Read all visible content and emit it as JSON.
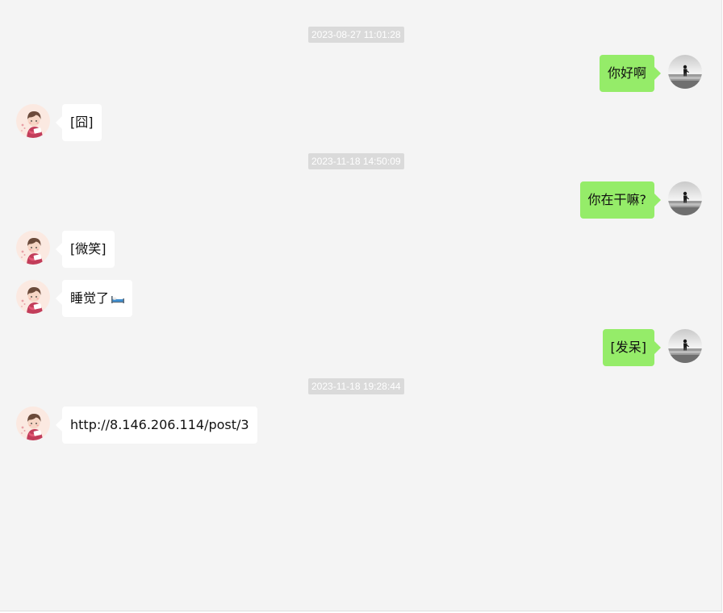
{
  "timestamps": [
    "2023-08-27 11:01:28",
    "2023-11-18 14:50:09",
    "2023-11-18 19:28:44"
  ],
  "messages": [
    {
      "sender": "me",
      "text": "你好啊"
    },
    {
      "sender": "other",
      "text": "[囧]"
    },
    {
      "sender": "me",
      "text": "你在干嘛?"
    },
    {
      "sender": "other",
      "text": "[微笑]"
    },
    {
      "sender": "other",
      "text": "睡觉了",
      "emoji": "bed-emoji-icon"
    },
    {
      "sender": "me",
      "text": "[发呆]"
    },
    {
      "sender": "other",
      "text": "http://8.146.206.114/post/3"
    }
  ],
  "colors": {
    "background": "#f4f4f4",
    "my_bubble": "#95ec69",
    "other_bubble": "#ffffff",
    "timestamp_bg": "#dadada",
    "timestamp_text": "#ffffff"
  },
  "avatars": {
    "me": "silhouette-by-sea-avatar",
    "other": "cartoon-girl-avatar"
  }
}
